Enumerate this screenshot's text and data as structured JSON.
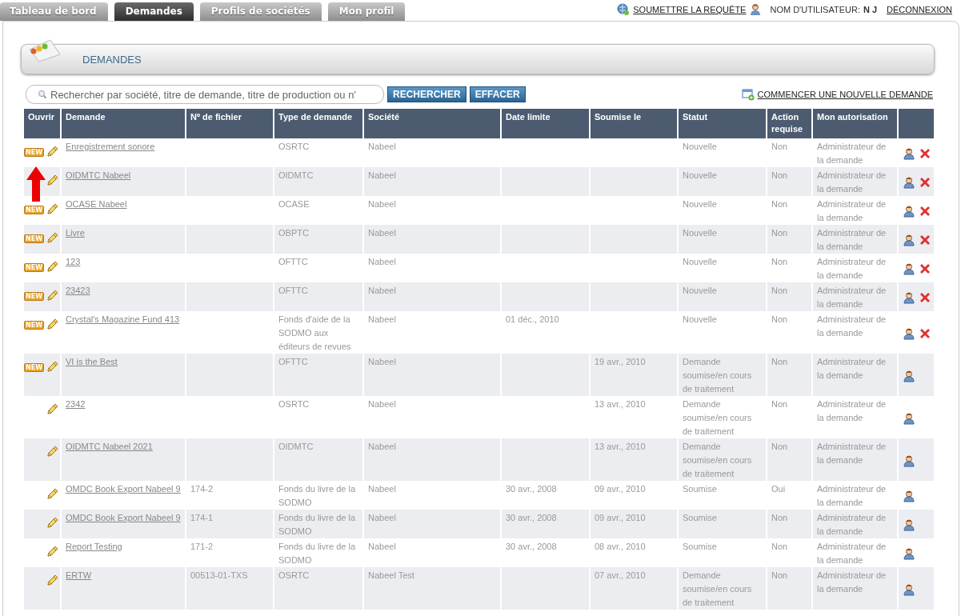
{
  "tabs": [
    {
      "label": "Tableau de bord",
      "selected": false
    },
    {
      "label": "Demandes",
      "selected": true
    },
    {
      "label": "Profils de sociétés",
      "selected": false
    },
    {
      "label": "Mon profil",
      "selected": false
    }
  ],
  "top_links": {
    "submit": "SOUMETTRE LA REQUÊTE",
    "user_label": "NOM D'UTILISATEUR:",
    "user_name": "N J",
    "logout": "DÉCONNEXION"
  },
  "section_title": "DEMANDES",
  "search": {
    "placeholder": "Rechercher par société, titre de demande, titre de production ou n'",
    "search_button": "RECHERCHER",
    "clear_button": "EFFACER"
  },
  "new_request": "COMMENCER UNE NOUVELLE DEMANDE",
  "table": {
    "columns": [
      "Ouvrir",
      "Demande",
      "Nº de fichier",
      "Type de demande",
      "Société",
      "Date limite",
      "Soumise le",
      "Statut",
      "Action requise",
      "Mon autorisation"
    ],
    "rows": [
      {
        "badge": "NEW",
        "demande": "Enregistrement sonore",
        "fichier": "",
        "type": "OSRTC",
        "societe": "Nabeel",
        "limite": "",
        "soumise": "",
        "statut": "Nouvelle",
        "action": "Non",
        "autorisation": "Administrateur de la demande",
        "deletable": true
      },
      {
        "demande": "OIDMTC Nabeel",
        "fichier": "",
        "type": "OIDMTC",
        "societe": "Nabeel",
        "limite": "",
        "soumise": "",
        "statut": "Nouvelle",
        "action": "Non",
        "autorisation": "Administrateur de la demande",
        "deletable": true,
        "arrow": true
      },
      {
        "badge": "NEW",
        "demande": "OCASE Nabeel",
        "fichier": "",
        "type": "OCASE",
        "societe": "Nabeel",
        "limite": "",
        "soumise": "",
        "statut": "Nouvelle",
        "action": "Non",
        "autorisation": "Administrateur de la demande",
        "deletable": true
      },
      {
        "badge": "NEW",
        "demande": "Livre",
        "fichier": "",
        "type": "OBPTC",
        "societe": "Nabeel",
        "limite": "",
        "soumise": "",
        "statut": "Nouvelle",
        "action": "Non",
        "autorisation": "Administrateur de la demande",
        "deletable": true
      },
      {
        "badge": "NEW",
        "demande": "123",
        "fichier": "",
        "type": "OFTTC",
        "societe": "Nabeel",
        "limite": "",
        "soumise": "",
        "statut": "Nouvelle",
        "action": "Non",
        "autorisation": "Administrateur de la demande",
        "deletable": true
      },
      {
        "badge": "NEW",
        "demande": "23423",
        "fichier": "",
        "type": "OFTTC",
        "societe": "Nabeel",
        "limite": "",
        "soumise": "",
        "statut": "Nouvelle",
        "action": "Non",
        "autorisation": "Administrateur de la demande",
        "deletable": true
      },
      {
        "badge": "NEW",
        "demande": "Crystal's Magazine Fund 413",
        "fichier": "",
        "type": "Fonds d'aide de la SODMO aux éditeurs de revues",
        "societe": "Nabeel",
        "limite": "01 déc., 2010",
        "soumise": "",
        "statut": "Nouvelle",
        "action": "Non",
        "autorisation": "Administrateur de la demande",
        "deletable": true
      },
      {
        "badge": "NEW",
        "demande": "VI is the Best",
        "fichier": "",
        "type": "OFTTC",
        "societe": "Nabeel",
        "limite": "",
        "soumise": "19 avr., 2010",
        "statut": "Demande soumise/en cours de traitement",
        "action": "Non",
        "autorisation": "Administrateur de la demande",
        "deletable": false
      },
      {
        "demande": "2342",
        "fichier": "",
        "type": "OSRTC",
        "societe": "Nabeel",
        "limite": "",
        "soumise": "13 avr., 2010",
        "statut": "Demande soumise/en cours de traitement",
        "action": "Non",
        "autorisation": "Administrateur de la demande",
        "deletable": false
      },
      {
        "demande": "OIDMTC Nabeel 2021",
        "fichier": "",
        "type": "OIDMTC",
        "societe": "Nabeel",
        "limite": "",
        "soumise": "13 avr., 2010",
        "statut": "Demande soumise/en cours de traitement",
        "action": "Non",
        "autorisation": "Administrateur de la demande",
        "deletable": false
      },
      {
        "demande": "OMDC Book Export Nabeel 9",
        "fichier": "174-2",
        "type": "Fonds du livre de la SODMO",
        "societe": "Nabeel",
        "limite": "30 avr., 2008",
        "soumise": "09 avr., 2010",
        "statut": "Soumise",
        "action": "Oui",
        "autorisation": "Administrateur de la demande",
        "deletable": false
      },
      {
        "demande": "OMDC Book Export Nabeel 9",
        "fichier": "174-1",
        "type": "Fonds du livre de la SODMO",
        "societe": "Nabeel",
        "limite": "30 avr., 2008",
        "soumise": "09 avr., 2010",
        "statut": "Soumise",
        "action": "Non",
        "autorisation": "Administrateur de la demande",
        "deletable": false
      },
      {
        "demande": "Report Testing",
        "fichier": "171-2",
        "type": "Fonds du livre de la SODMO",
        "societe": "Nabeel",
        "limite": "30 avr., 2008",
        "soumise": "08 avr., 2010",
        "statut": "Soumise",
        "action": "Non",
        "autorisation": "Administrateur de la demande",
        "deletable": false
      },
      {
        "demande": "ERTW",
        "fichier": "00513-01-TXS",
        "type": "OSRTC",
        "societe": "Nabeel Test",
        "limite": "",
        "soumise": "07 avr., 2010",
        "statut": "Demande soumise/en cours de traitement",
        "action": "Non",
        "autorisation": "Administrateur de la demande",
        "deletable": false
      }
    ]
  }
}
